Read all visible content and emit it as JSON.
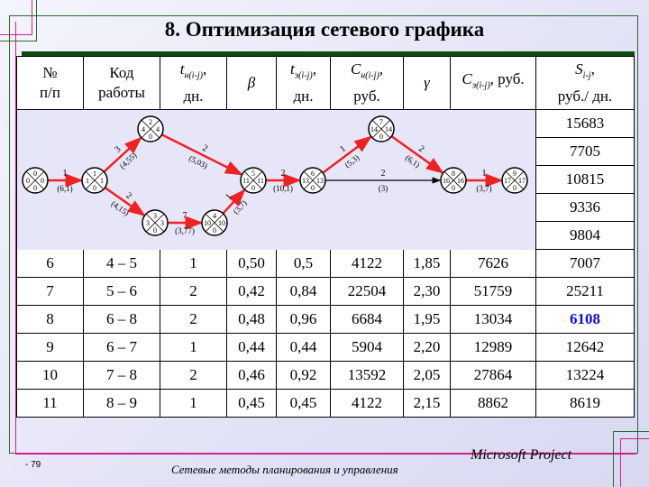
{
  "title": "8. Оптимизация сетевого графика",
  "table": {
    "headers": [
      {
        "main": "№",
        "line2": "п/п"
      },
      {
        "main": "Код",
        "line2": "работы"
      },
      {
        "main": "t",
        "sub": "н(i-j)",
        "tail": ",",
        "line2": "дн."
      },
      {
        "main": "β"
      },
      {
        "main": "t",
        "sub": "э(i-j)",
        "tail": ",",
        "line2": "дн."
      },
      {
        "main": "C",
        "sub": "н(i-j)",
        "tail": ",",
        "line2": "руб."
      },
      {
        "main": "γ"
      },
      {
        "main": "C",
        "sub": "э(i-j)",
        "tail": ", руб."
      },
      {
        "main": "S",
        "sub": "i-j",
        "tail": ",",
        "line2": "руб./ дн."
      }
    ],
    "hidden_rows_s": [
      "15683",
      "7705",
      "10815",
      "9336",
      "9804"
    ],
    "rows": [
      [
        "6",
        "4 – 5",
        "1",
        "0,50",
        "0,5",
        "4122",
        "1,85",
        "7626",
        "7007"
      ],
      [
        "7",
        "5 – 6",
        "2",
        "0,42",
        "0,84",
        "22504",
        "2,30",
        "51759",
        "25211"
      ],
      [
        "8",
        "6 – 8",
        "2",
        "0,48",
        "0,96",
        "6684",
        "1,95",
        "13034",
        "6108"
      ],
      [
        "9",
        "6 – 7",
        "1",
        "0,44",
        "0,44",
        "5904",
        "2,20",
        "12989",
        "12642"
      ],
      [
        "10",
        "7 – 8",
        "2",
        "0,46",
        "0,92",
        "13592",
        "2,05",
        "27864",
        "13224"
      ],
      [
        "11",
        "8 – 9",
        "1",
        "0,45",
        "0,45",
        "4122",
        "2,15",
        "8862",
        "8619"
      ]
    ],
    "highlight_color": "#1010d0"
  },
  "network": {
    "critical_color": "#ee2222",
    "nodes": [
      {
        "id": "0",
        "early": "0",
        "late": "0",
        "reserve": "0"
      },
      {
        "id": "1",
        "early": "1",
        "late": "1",
        "reserve": "0"
      },
      {
        "id": "2",
        "early": "4",
        "late": "4",
        "reserve": "0"
      },
      {
        "id": "3",
        "early": "3",
        "late": "3",
        "reserve": "0"
      },
      {
        "id": "4",
        "early": "10",
        "late": "10",
        "reserve": "0"
      },
      {
        "id": "5",
        "early": "11",
        "late": "11",
        "reserve": "0"
      },
      {
        "id": "6",
        "early": "13",
        "late": "13",
        "reserve": "0"
      },
      {
        "id": "7",
        "early": "14",
        "late": "14",
        "reserve": "0"
      },
      {
        "id": "8",
        "early": "16",
        "late": "16",
        "reserve": "0"
      },
      {
        "id": "9",
        "early": "17",
        "late": "17",
        "reserve": "0"
      }
    ],
    "edges": [
      {
        "from": "0",
        "to": "1",
        "duration": "1",
        "params": "(6,1)",
        "critical": true
      },
      {
        "from": "1",
        "to": "2",
        "duration": "3",
        "params": "(4,55)",
        "critical": true
      },
      {
        "from": "1",
        "to": "3",
        "duration": "2",
        "params": "(4,15)",
        "critical": true
      },
      {
        "from": "2",
        "to": "5",
        "duration": "2",
        "params": "(5,03)",
        "critical": true
      },
      {
        "from": "3",
        "to": "4",
        "duration": "7",
        "params": "(3,77)",
        "critical": true
      },
      {
        "from": "4",
        "to": "5",
        "duration": "1",
        "params": "(3,7)",
        "critical": true
      },
      {
        "from": "5",
        "to": "6",
        "duration": "2",
        "params": "(10,1)",
        "critical": true
      },
      {
        "from": "6",
        "to": "7",
        "duration": "1",
        "params": "(5,3)",
        "critical": true
      },
      {
        "from": "6",
        "to": "8",
        "duration": "2",
        "params": "(3)",
        "critical": false
      },
      {
        "from": "7",
        "to": "8",
        "duration": "2",
        "params": "(6,1)",
        "critical": true
      },
      {
        "from": "8",
        "to": "9",
        "duration": "1",
        "params": "(3,7)",
        "critical": true
      }
    ]
  },
  "footer": {
    "slide_number": "- 79",
    "text": "Сетевые методы планирования и управления",
    "brand": "Microsoft Project"
  }
}
